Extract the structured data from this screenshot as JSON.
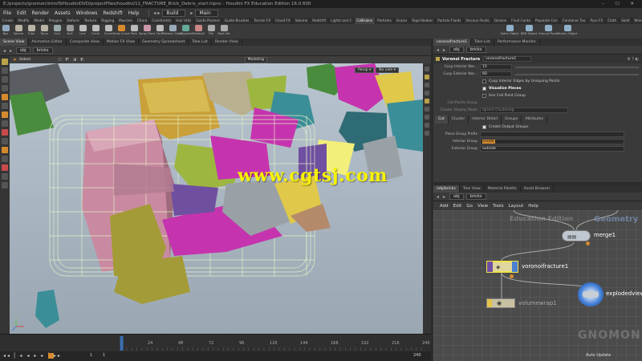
{
  "window": {
    "title": "E:/projects/gnomon/introToHoudiniDVD/projectFiles/houdini/11_FRACTURE_Brick_Debris_start.hipnc - Houdini FX Education Edition 16.0.600",
    "controls": "–  ☐  ✕"
  },
  "menubar": {
    "items": [
      "File",
      "Edit",
      "Render",
      "Assets",
      "Windows",
      "Redshift",
      "Help"
    ],
    "build_label": "Build",
    "main_label": "Main"
  },
  "shelf": {
    "tabs": [
      "Create",
      "Modify",
      "Model",
      "Polygon",
      "Deform",
      "Texture",
      "Rigging",
      "Muscles",
      "Chara",
      "Constraints",
      "Hair Utils",
      "Guide Process",
      "Guide Brushes",
      "Terrain FX",
      "Cloud FX",
      "Volume",
      "Redshift",
      "Lights and C",
      "Collisions",
      "Particles",
      "Grains",
      "Rigid Bodies",
      "Particle Fluids",
      "Viscous Fluids",
      "Oceans",
      "Fluid Conta",
      "Populate Con",
      "Container Too",
      "Pyro FX",
      "Cloth",
      "Solid",
      "Wires",
      "Crowds",
      "Drive Simul"
    ],
    "active_tab_index": 18,
    "tools": [
      "Box",
      "Sphere",
      "Tube",
      "Torus",
      "Grid",
      "Null",
      "Line",
      "Circle",
      "Curve",
      "Draw Curve",
      "Path",
      "Spray Paint",
      "Font",
      "Platonic Solids",
      "L-System",
      "Metaball",
      "File",
      "Rest Get"
    ],
    "right_tools": [
      "Static Object",
      "RBD Object",
      "Ground Plane",
      "Terrain Object"
    ]
  },
  "viewport_pane": {
    "tabs": [
      "Scene View",
      "Animation Editor",
      "Composite View",
      "Motion FX View",
      "Geometry Spreadsheet",
      "Take List",
      "Render View"
    ],
    "path": [
      "obj",
      "bricks"
    ],
    "select_label": "Select",
    "view_label": "Persp ▾",
    "cam_label": "No cam ▾",
    "mode_label": "Modeling"
  },
  "parm_pane": {
    "tabs": [
      "voronoifracture1",
      "Take List",
      "Performance Monitor"
    ],
    "path": [
      "obj",
      "bricks"
    ],
    "node_type": "Voronoi Fracture",
    "node_name": "voronoifracture1",
    "parms": [
      {
        "label": "Cusp Interior Nor...",
        "value": "15"
      },
      {
        "label": "Cusp Exterior Nor...",
        "value": "60"
      }
    ],
    "checks": [
      {
        "label": "Cusp Interior Edges by Unsquing Points",
        "on": false
      },
      {
        "label": "Visualize Pieces",
        "on": true
      },
      {
        "label": "Use Cell Point Group",
        "on": false
      }
    ],
    "cell_point_group_label": "Cell Points Group",
    "cluster_label": "Cluster Display Mode",
    "cluster_value": "Ignore Clustering",
    "subtabs": [
      "Cut",
      "Cluster",
      "Interior Detail",
      "Groups",
      "Attributes"
    ],
    "create_groups_label": "Create Output Groups",
    "piece_prefix_label": "Piece Group Prefix",
    "piece_prefix_value": "",
    "interior_label": "Interior Group",
    "interior_value": "inside",
    "exterior_label": "Exterior Group",
    "exterior_value": "outside"
  },
  "network_pane": {
    "tabs": [
      "/obj/bricks",
      "Tree View",
      "Material Palette",
      "Asset Browser"
    ],
    "path": [
      "obj",
      "bricks"
    ],
    "menu": [
      "Add",
      "Edit",
      "Go",
      "View",
      "Tools",
      "Layout",
      "Help"
    ],
    "bg_label_left": "Education Edition",
    "bg_label_right": "Geometry",
    "nodes": [
      {
        "name": "merge1"
      },
      {
        "name": "voronoifracture1"
      },
      {
        "name": "explodedview"
      },
      {
        "name": "volumewrap1"
      }
    ]
  },
  "timeline": {
    "ticks": [
      "24",
      "48",
      "72",
      "96",
      "120",
      "144",
      "168",
      "192",
      "216",
      "240"
    ],
    "current_frame": "1",
    "start_frame": "1",
    "end_frame": "240",
    "end_frame2": "240",
    "auto_update": "Auto Update"
  },
  "watermark": "www.cgtsj.com",
  "brand": "GNOMON",
  "colors": {
    "pink": "#c98aa1",
    "green": "#9db640",
    "magenta": "#c534ae",
    "teal": "#3b8e98",
    "yellow": "#f7f200",
    "olive": "#a39b37",
    "gray": "#9aa1a6",
    "orange": "#c98a32",
    "purple": "#6f4fa0",
    "wire": "#e9f6c8"
  }
}
